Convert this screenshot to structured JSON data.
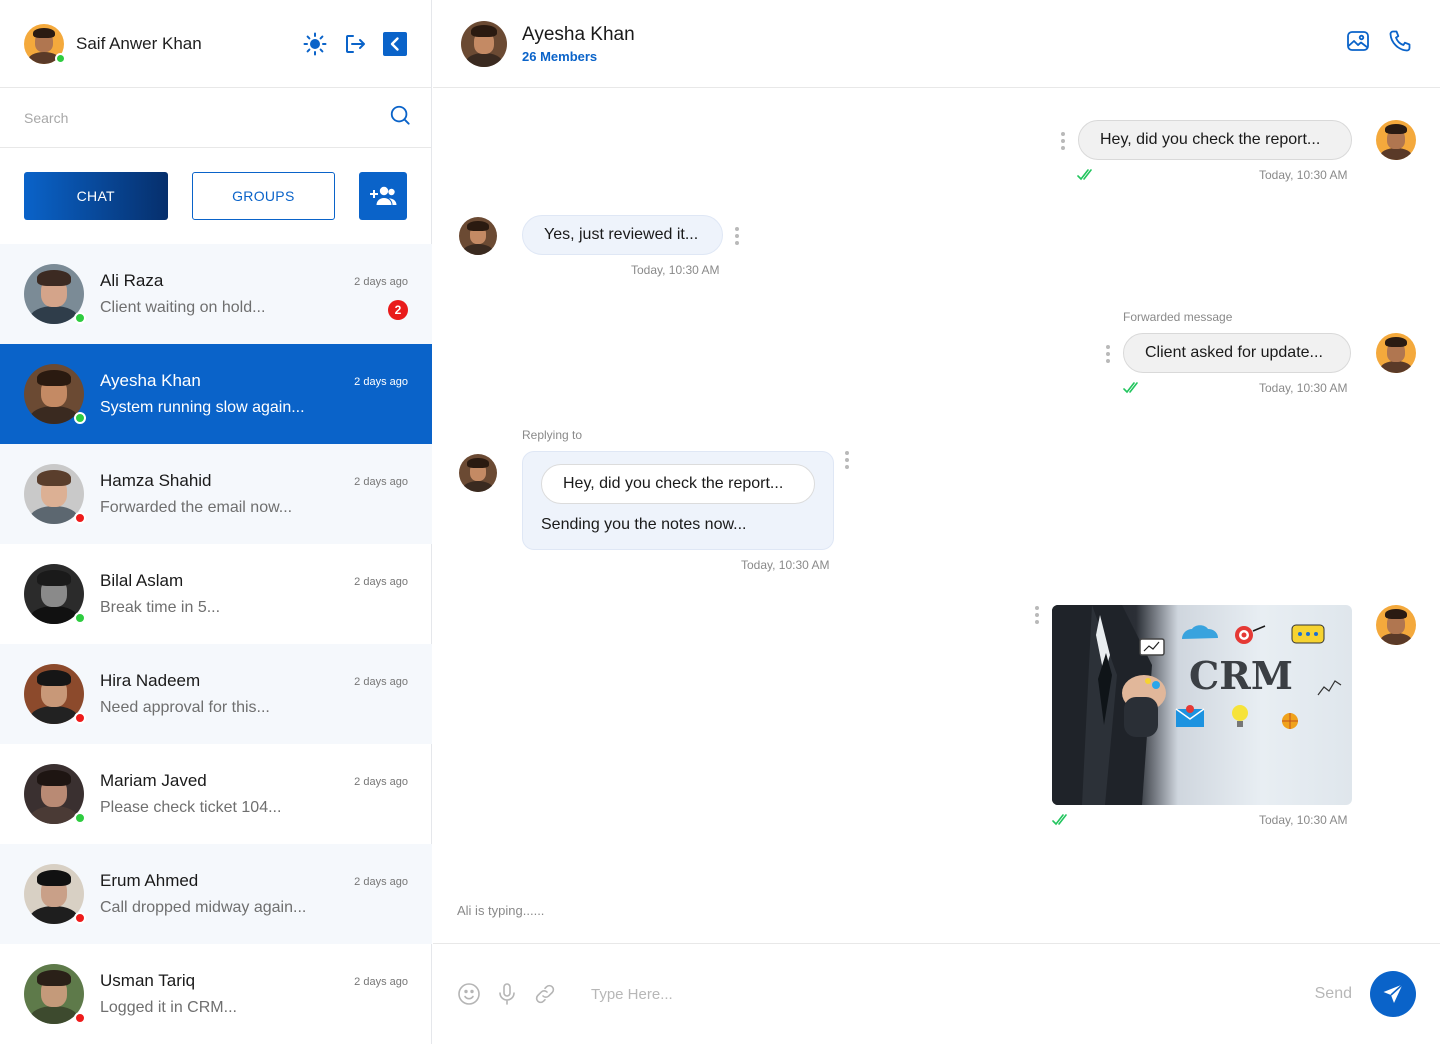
{
  "sidebar": {
    "user": {
      "name": "Saif Anwer Khan",
      "status": "online"
    },
    "search_placeholder": "Search",
    "tabs": {
      "chat": "CHAT",
      "groups": "GROUPS"
    },
    "chats": [
      {
        "name": "Ali Raza",
        "preview": "Client waiting on hold...",
        "time": "2 days ago",
        "unread": "2",
        "status": "online"
      },
      {
        "name": "Ayesha Khan",
        "preview": "System running slow again...",
        "time": "2 days ago",
        "unread": "",
        "status": "online"
      },
      {
        "name": "Hamza Shahid",
        "preview": "Forwarded the email now...",
        "time": "2 days ago",
        "unread": "",
        "status": "offline"
      },
      {
        "name": "Bilal Aslam",
        "preview": "Break time in 5...",
        "time": "2 days ago",
        "unread": "",
        "status": "online"
      },
      {
        "name": "Hira Nadeem",
        "preview": "Need approval for this...",
        "time": "2 days ago",
        "unread": "",
        "status": "offline"
      },
      {
        "name": "Mariam Javed",
        "preview": "Please check ticket 104...",
        "time": "2 days ago",
        "unread": "",
        "status": "online"
      },
      {
        "name": "Erum Ahmed",
        "preview": "Call dropped midway again...",
        "time": "2 days ago",
        "unread": "",
        "status": "offline"
      },
      {
        "name": "Usman Tariq",
        "preview": "Logged it in CRM...",
        "time": "2 days ago",
        "unread": "",
        "status": "offline"
      }
    ]
  },
  "conversation": {
    "title": "Ayesha Khan",
    "subtitle": "26 Members",
    "messages": {
      "m1": {
        "text": "Hey, did you check the report...",
        "time": "Today, 10:30 AM"
      },
      "m2": {
        "text": "Yes, just reviewed it...",
        "time": "Today, 10:30 AM"
      },
      "m3": {
        "label": "Forwarded message",
        "text": "Client asked for update...",
        "time": "Today, 10:30 AM"
      },
      "m4": {
        "label": "Replying to",
        "quote": "Hey, did you check the report...",
        "text": "Sending you the notes now...",
        "time": "Today, 10:30 AM"
      },
      "m5": {
        "image_text": "CRM",
        "time": "Today, 10:30 AM"
      }
    },
    "typing": "Ali is typing......"
  },
  "composer": {
    "placeholder": "Type Here...",
    "send_label": "Send"
  },
  "colors": {
    "accent": "#0a63c9",
    "online": "#2ecc40",
    "offline": "#ee1b1b",
    "badge": "#e91b1b",
    "read_tick": "#22c55e"
  }
}
